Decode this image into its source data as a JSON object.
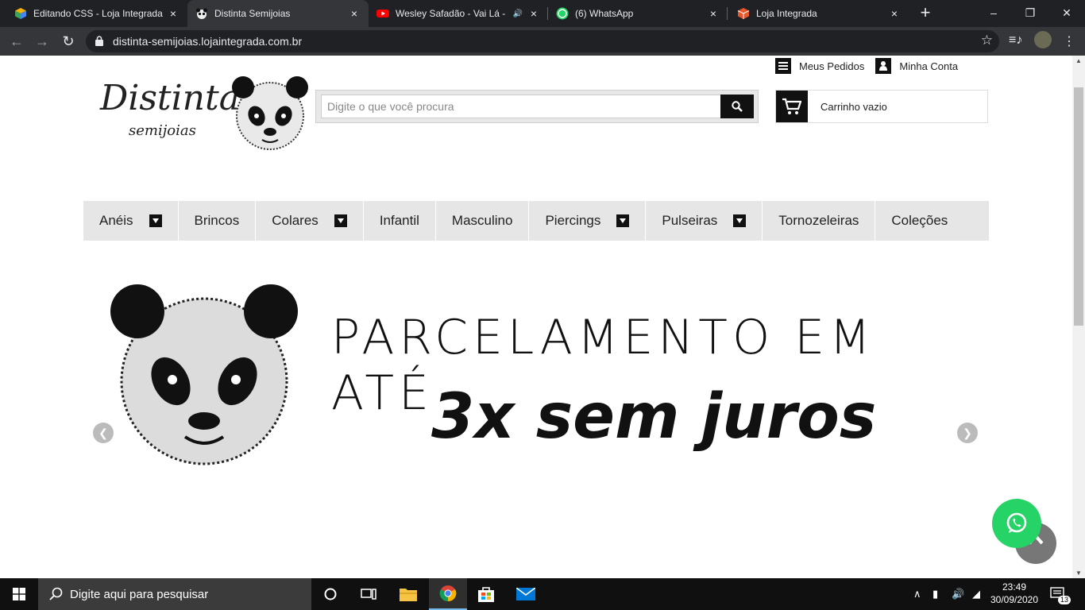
{
  "browser": {
    "tabs": [
      {
        "label": "Editando CSS - Loja Integrada",
        "close": "×",
        "active": false
      },
      {
        "label": "Distinta Semijoias",
        "close": "×",
        "active": true
      },
      {
        "label": "Wesley Safadão - Vai Lá - ",
        "close": "×",
        "active": false,
        "audio": "🔊"
      },
      {
        "label": "(6) WhatsApp",
        "close": "×",
        "active": false
      },
      {
        "label": "Loja Integrada",
        "close": "×",
        "active": false
      }
    ],
    "new_tab": "+",
    "url": "distinta-semijoias.lojaintegrada.com.br",
    "colors": {
      "frame": "#202124",
      "toolbar": "#35363a",
      "text": "#e8eaed"
    }
  },
  "site": {
    "logo": {
      "title": "Distinta",
      "subtitle": "semijoias"
    },
    "search": {
      "placeholder": "Digite o que você procura"
    },
    "links": {
      "orders": "Meus Pedidos",
      "account": "Minha Conta"
    },
    "cart": {
      "label": "Carrinho vazio"
    },
    "menu": [
      {
        "label": "Anéis",
        "dropdown": true
      },
      {
        "label": "Brincos",
        "dropdown": false
      },
      {
        "label": "Colares",
        "dropdown": true
      },
      {
        "label": "Infantil",
        "dropdown": false
      },
      {
        "label": "Masculino",
        "dropdown": false
      },
      {
        "label": "Piercings",
        "dropdown": true
      },
      {
        "label": "Pulseiras",
        "dropdown": true
      },
      {
        "label": "Tornozeleiras",
        "dropdown": false
      },
      {
        "label": "Coleções",
        "dropdown": false
      }
    ],
    "banner": {
      "headline": "PARCELAMENTO EM ATÉ",
      "sub": "3x sem juros"
    },
    "colors": {
      "menu_bg": "#e6e6e6",
      "accent": "#111111",
      "whatsapp": "#25d366"
    }
  },
  "taskbar": {
    "search_placeholder": "Digite aqui para pesquisar",
    "time": "23:49",
    "date": "30/09/2020",
    "notifications": "13"
  }
}
